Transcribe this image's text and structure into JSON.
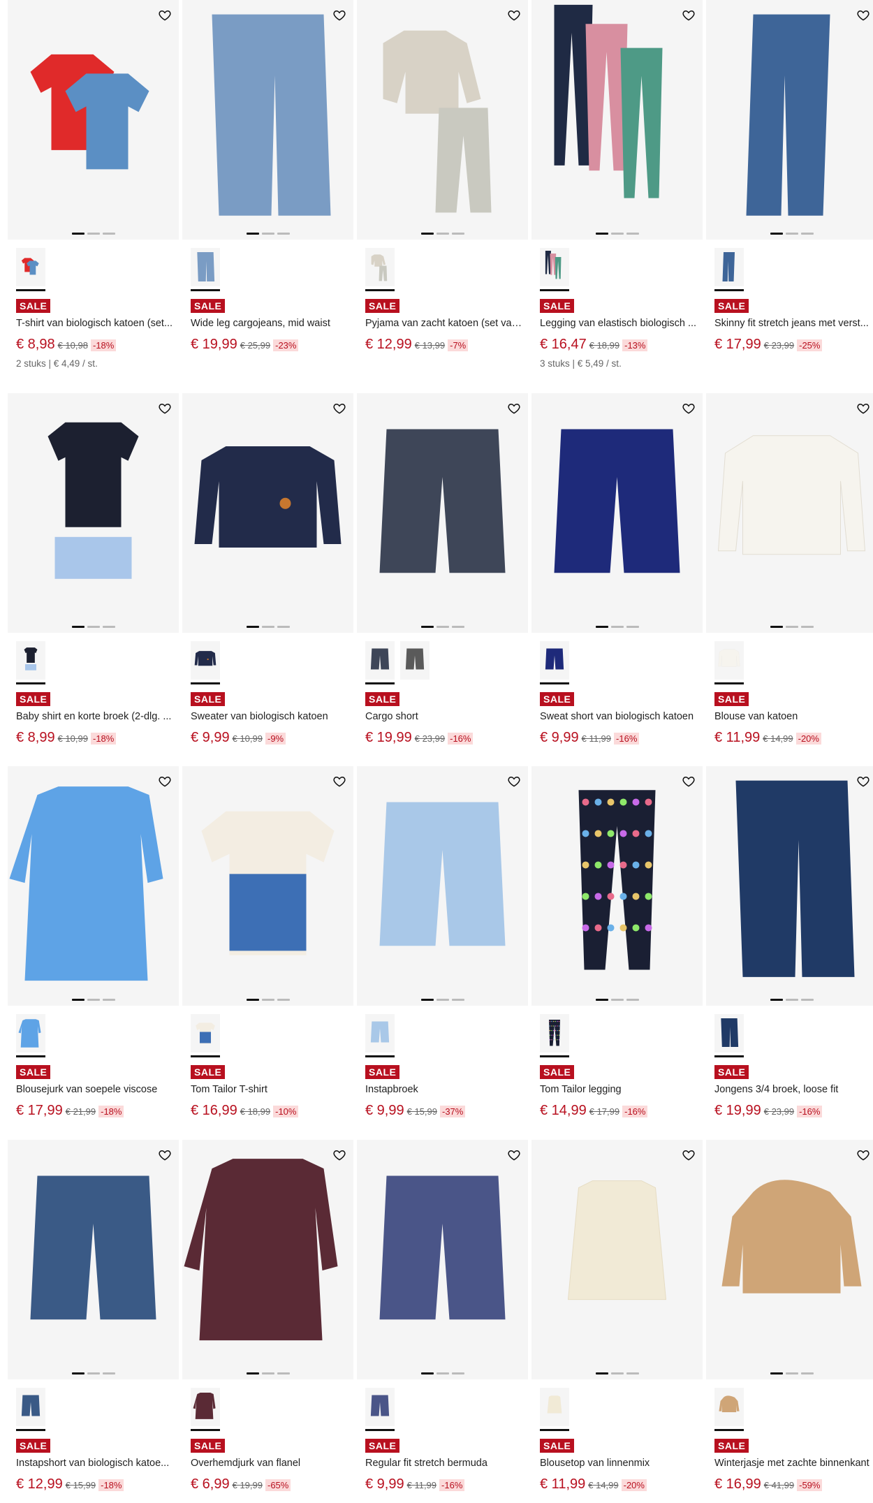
{
  "products": [
    {
      "name": "T-shirt van biologisch katoen (set...",
      "price": "€ 8,98",
      "old": "€ 10,98",
      "disc": "-18%",
      "badge": "SALE",
      "unit": "2 stuks | € 4,49 / st.",
      "img": "tshirts",
      "colors": [
        "#e02a2a",
        "#5b8fc4"
      ],
      "swatches": 1
    },
    {
      "name": "Wide leg cargojeans, mid waist",
      "price": "€ 19,99",
      "old": "€ 25,99",
      "disc": "-23%",
      "badge": "SALE",
      "unit": "",
      "img": "jeanswide",
      "colors": [
        "#7a9cc4"
      ],
      "swatches": 1
    },
    {
      "name": "Pyjama van zacht katoen (set van...",
      "price": "€ 12,99",
      "old": "€ 13,99",
      "disc": "-7%",
      "badge": "SALE",
      "unit": "",
      "img": "pyjama",
      "colors": [
        "#d8d2c6",
        "#c9c9c0"
      ],
      "swatches": 1
    },
    {
      "name": "Legging van elastisch biologisch ...",
      "price": "€ 16,47",
      "old": "€ 18,99",
      "disc": "-13%",
      "badge": "SALE",
      "unit": "3 stuks | € 5,49 / st.",
      "img": "leggings3",
      "colors": [
        "#1f2a44",
        "#d88fa0",
        "#4e9a86"
      ],
      "swatches": 1
    },
    {
      "name": "Skinny fit stretch jeans met verst...",
      "price": "€ 17,99",
      "old": "€ 23,99",
      "disc": "-25%",
      "badge": "SALE",
      "unit": "",
      "img": "skinny",
      "colors": [
        "#3e6598"
      ],
      "swatches": 1
    },
    {
      "name": "Baby shirt en korte broek (2-dlg. ...",
      "price": "€ 8,99",
      "old": "€ 10,99",
      "disc": "-18%",
      "badge": "SALE",
      "unit": "",
      "img": "babyset",
      "colors": [
        "#1c2030",
        "#a9c6ea"
      ],
      "swatches": 1
    },
    {
      "name": "Sweater van biologisch katoen",
      "price": "€ 9,99",
      "old": "€ 10,99",
      "disc": "-9%",
      "badge": "SALE",
      "unit": "",
      "img": "sweater",
      "colors": [
        "#222b4a"
      ],
      "swatches": 1
    },
    {
      "name": "Cargo short",
      "price": "€ 19,99",
      "old": "€ 23,99",
      "disc": "-16%",
      "badge": "SALE",
      "unit": "",
      "img": "cargoshort",
      "colors": [
        "#3e4658"
      ],
      "swatches": 2
    },
    {
      "name": "Sweat short van biologisch katoen",
      "price": "€ 9,99",
      "old": "€ 11,99",
      "disc": "-16%",
      "badge": "SALE",
      "unit": "",
      "img": "sweatshort",
      "colors": [
        "#1e2a7a"
      ],
      "swatches": 1
    },
    {
      "name": "Blouse van katoen",
      "price": "€ 11,99",
      "old": "€ 14,99",
      "disc": "-20%",
      "badge": "SALE",
      "unit": "",
      "img": "blouse",
      "colors": [
        "#f6f4ee"
      ],
      "swatches": 1
    },
    {
      "name": "Blousejurk van soepele viscose",
      "price": "€ 17,99",
      "old": "€ 21,99",
      "disc": "-18%",
      "badge": "SALE",
      "unit": "",
      "img": "dressblue",
      "colors": [
        "#5ea3e6"
      ],
      "swatches": 1
    },
    {
      "name": "Tom Tailor T-shirt",
      "price": "€ 16,99",
      "old": "€ 18,99",
      "disc": "-10%",
      "badge": "SALE",
      "unit": "",
      "img": "nyshirt",
      "colors": [
        "#f3ede2",
        "#3d6fb5"
      ],
      "swatches": 1
    },
    {
      "name": "Instapbroek",
      "price": "€ 9,99",
      "old": "€ 15,99",
      "disc": "-37%",
      "badge": "SALE",
      "unit": "",
      "img": "lightshort",
      "colors": [
        "#a9c8e8"
      ],
      "swatches": 1
    },
    {
      "name": "Tom Tailor legging",
      "price": "€ 14,99",
      "old": "€ 17,99",
      "disc": "-16%",
      "badge": "SALE",
      "unit": "",
      "img": "dotlegging",
      "colors": [
        "#1a1f33"
      ],
      "swatches": 1
    },
    {
      "name": "Jongens 3/4 broek, loose fit",
      "price": "€ 19,99",
      "old": "€ 23,99",
      "disc": "-16%",
      "badge": "SALE",
      "unit": "",
      "img": "navycargo",
      "colors": [
        "#203a66"
      ],
      "swatches": 1
    },
    {
      "name": "Instapshort van biologisch katoe...",
      "price": "€ 12,99",
      "old": "€ 15,99",
      "disc": "-18%",
      "badge": "SALE",
      "unit": "",
      "img": "denimshort",
      "colors": [
        "#3a5a86"
      ],
      "swatches": 1
    },
    {
      "name": "Overhemdjurk van flanel",
      "price": "€ 6,99",
      "old": "€ 19,99",
      "disc": "-65%",
      "badge": "SALE",
      "unit": "",
      "img": "flanel",
      "colors": [
        "#5a2a35"
      ],
      "swatches": 1
    },
    {
      "name": "Regular fit stretch bermuda",
      "price": "€ 9,99",
      "old": "€ 11,99",
      "disc": "-16%",
      "badge": "SALE",
      "unit": "",
      "img": "bermuda",
      "colors": [
        "#4a5588"
      ],
      "swatches": 1
    },
    {
      "name": "Blousetop van linnenmix",
      "price": "€ 11,99",
      "old": "€ 14,99",
      "disc": "-20%",
      "badge": "SALE",
      "unit": "",
      "img": "top",
      "colors": [
        "#f1ead6"
      ],
      "swatches": 1
    },
    {
      "name": "Winterjasje met zachte binnenkant",
      "price": "€ 16,99",
      "old": "€ 41,99",
      "disc": "-59%",
      "badge": "SALE",
      "unit": "",
      "img": "jacket",
      "colors": [
        "#cfa577"
      ],
      "swatches": 1
    }
  ]
}
